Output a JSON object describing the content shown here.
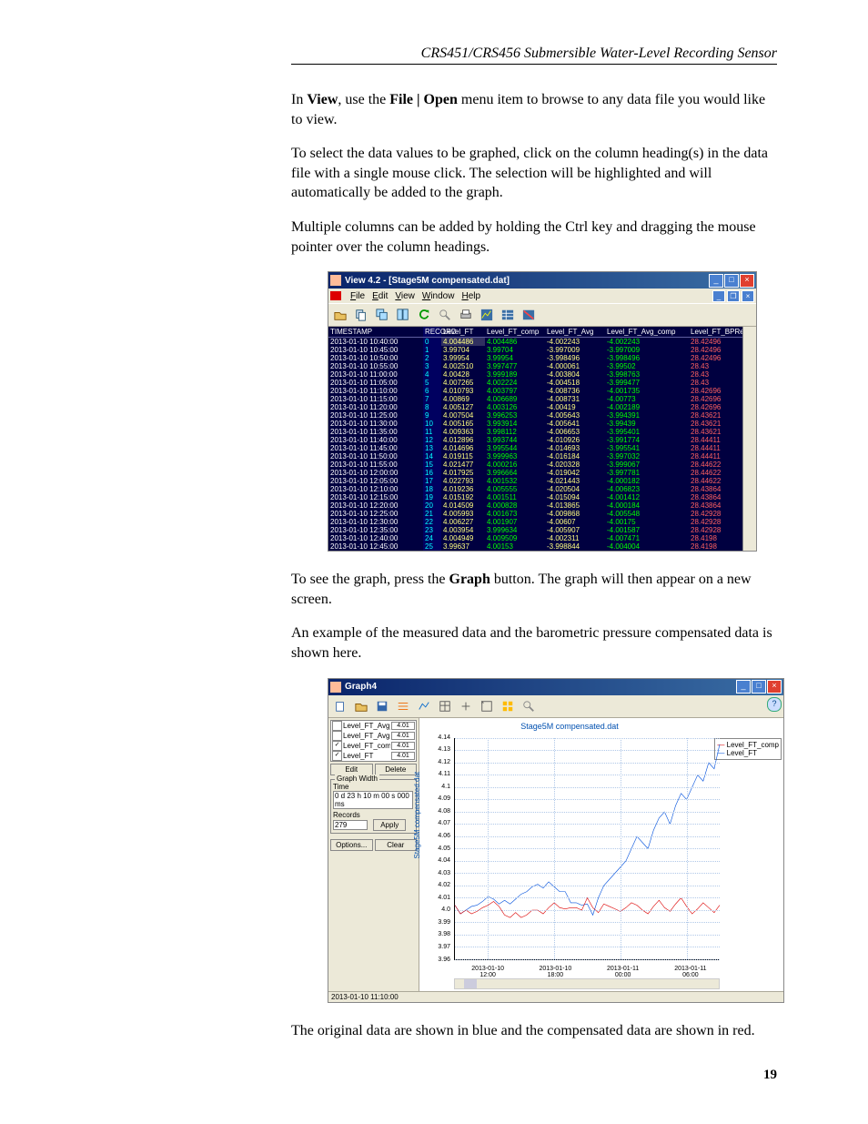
{
  "header": {
    "title": "CRS451/CRS456 Submersible Water-Level Recording Sensor"
  },
  "para1_pre": "In ",
  "para1_b1": "View",
  "para1_mid": ", use the ",
  "para1_b2": "File | Open",
  "para1_post": " menu item to browse to any data file you would like to view.",
  "para2": "To select the data values to be graphed, click on the column heading(s) in the data file with a single mouse click.  The selection will be highlighted and will automatically be added to the graph.",
  "para3": "Multiple columns can be added by holding the Ctrl key and dragging the mouse pointer over the column headings.",
  "para4_pre": "To see the graph, press the ",
  "para4_b": "Graph",
  "para4_post": " button.  The graph will then appear on a new screen.",
  "para5": "An example of the measured data and the barometric pressure compensated data is shown here.",
  "para6": "The original data are shown in blue and the compensated data are shown in red.",
  "pagenum": "19",
  "win1": {
    "title": "View 4.2 - [Stage5M compensated.dat]",
    "menu": [
      "File",
      "Edit",
      "View",
      "Window",
      "Help"
    ],
    "cols": [
      "TIMESTAMP",
      "RECORD",
      "Level_FT",
      "Level_FT_comp",
      "Level_FT_Avg",
      "Level_FT_Avg_comp",
      "Level_FT_BPRef"
    ],
    "rows": [
      [
        "2013-01-10 10:40:00",
        "0",
        "4.004486",
        "4.004486",
        "-4.002243",
        "-4.002243",
        "28.42496"
      ],
      [
        "2013-01-10 10:45:00",
        "1",
        "3.99704",
        "3.99704",
        "-3.997009",
        "-3.997009",
        "28.42496"
      ],
      [
        "2013-01-10 10:50:00",
        "2",
        "3.99954",
        "3.99954",
        "-3.998496",
        "-3.998496",
        "28.42496"
      ],
      [
        "2013-01-10 10:55:00",
        "3",
        "4.002510",
        "3.997477",
        "-4.000061",
        "-3.99502",
        "28.43"
      ],
      [
        "2013-01-10 11:00:00",
        "4",
        "4.00428",
        "3.999189",
        "-4.003804",
        "-3.998763",
        "28.43"
      ],
      [
        "2013-01-10 11:05:00",
        "5",
        "4.007265",
        "4.002224",
        "-4.004518",
        "-3.999477",
        "28.43"
      ],
      [
        "2013-01-10 11:10:00",
        "6",
        "4.010793",
        "4.003797",
        "-4.008736",
        "-4.001735",
        "28.42696"
      ],
      [
        "2013-01-10 11:15:00",
        "7",
        "4.00869",
        "4.006689",
        "-4.008731",
        "-4.00773",
        "28.42696"
      ],
      [
        "2013-01-10 11:20:00",
        "8",
        "4.005127",
        "4.003126",
        "-4.00419",
        "-4.002189",
        "28.42696"
      ],
      [
        "2013-01-10 11:25:00",
        "9",
        "4.007504",
        "3.996253",
        "-4.005643",
        "-3.994391",
        "28.43621"
      ],
      [
        "2013-01-10 11:30:00",
        "10",
        "4.005165",
        "3.993914",
        "-4.005641",
        "-3.99439",
        "28.43621"
      ],
      [
        "2013-01-10 11:35:00",
        "11",
        "4.009363",
        "3.998112",
        "-4.006653",
        "-3.995401",
        "28.43621"
      ],
      [
        "2013-01-10 11:40:00",
        "12",
        "4.012896",
        "3.993744",
        "-4.010926",
        "-3.991774",
        "28.44411"
      ],
      [
        "2013-01-10 11:45:00",
        "13",
        "4.014696",
        "3.995544",
        "-4.014693",
        "-3.995541",
        "28.44411"
      ],
      [
        "2013-01-10 11:50:00",
        "14",
        "4.019115",
        "3.999963",
        "-4.016184",
        "-3.997032",
        "28.44411"
      ],
      [
        "2013-01-10 11:55:00",
        "15",
        "4.021477",
        "4.000216",
        "-4.020328",
        "-3.999067",
        "28.44622"
      ],
      [
        "2013-01-10 12:00:00",
        "16",
        "4.017925",
        "3.996664",
        "-4.019042",
        "-3.997781",
        "28.44622"
      ],
      [
        "2013-01-10 12:05:00",
        "17",
        "4.022793",
        "4.001532",
        "-4.021443",
        "-4.000182",
        "28.44622"
      ],
      [
        "2013-01-10 12:10:00",
        "18",
        "4.019236",
        "4.005555",
        "-4.020504",
        "-4.006823",
        "28.43864"
      ],
      [
        "2013-01-10 12:15:00",
        "19",
        "4.015192",
        "4.001511",
        "-4.015094",
        "-4.001412",
        "28.43864"
      ],
      [
        "2013-01-10 12:20:00",
        "20",
        "4.014509",
        "4.000828",
        "-4.013865",
        "-4.000184",
        "28.43864"
      ],
      [
        "2013-01-10 12:25:00",
        "21",
        "4.005993",
        "4.001673",
        "-4.009868",
        "-4.005548",
        "28.42928"
      ],
      [
        "2013-01-10 12:30:00",
        "22",
        "4.006227",
        "4.001907",
        "-4.00607",
        "-4.00175",
        "28.42928"
      ],
      [
        "2013-01-10 12:35:00",
        "23",
        "4.003954",
        "3.999634",
        "-4.005907",
        "-4.001587",
        "28.42928"
      ],
      [
        "2013-01-10 12:40:00",
        "24",
        "4.004949",
        "4.009509",
        "-4.002311",
        "-4.007471",
        "28.4198"
      ],
      [
        "2013-01-10 12:45:00",
        "25",
        "3.99637",
        "4.00153",
        "-3.998844",
        "-4.004004",
        "28.4198"
      ]
    ]
  },
  "win2": {
    "title": "Graph4",
    "chart_title": "Stage5M compensated.dat",
    "ylabel": "Stage5M compensated.dat",
    "series_panel": [
      {
        "chk": "",
        "name": "Level_FT_Avg_com",
        "val": "4.01"
      },
      {
        "chk": "",
        "name": "Level_FT_Avg",
        "val": "4.01"
      },
      {
        "chk": "✓",
        "name": "Level_FT_comp",
        "val": "4.01"
      },
      {
        "chk": "✓",
        "name": "Level_FT",
        "val": "4.01"
      }
    ],
    "btn_edit": "Edit",
    "btn_delete": "Delete",
    "btn_options": "Options...",
    "btn_clear": "Clear",
    "btn_apply": "Apply",
    "gw_legend": "Graph Width",
    "gw_time": "Time",
    "gw_time_val": "0 d 23 h 10 m 00 s 000 ms",
    "gw_records": "Records",
    "gw_records_val": "279",
    "legend1": "Level_FT_comp",
    "legend2": "Level_FT",
    "yticks": [
      "4.14",
      "4.13",
      "4.12",
      "4.11",
      "4.1",
      "4.09",
      "4.08",
      "4.07",
      "4.06",
      "4.05",
      "4.04",
      "4.03",
      "4.02",
      "4.01",
      "4.0",
      "3.99",
      "3.98",
      "3.97",
      "3.96"
    ],
    "xticks": [
      "2013-01-10\n12:00",
      "2013-01-10\n18:00",
      "2013-01-11\n00:00",
      "2013-01-11\n06:00"
    ],
    "status": "2013-01-10 11:10:00"
  },
  "chart_data": {
    "type": "line",
    "title": "Stage5M compensated.dat",
    "ylabel": "Stage5M compensated.dat",
    "ylim": [
      3.96,
      4.14
    ],
    "x_range": [
      "2013-01-10 10:40",
      "2013-01-11 09:50"
    ],
    "series": [
      {
        "name": "Level_FT_comp",
        "color": "red",
        "values": [
          4.004,
          3.997,
          4.0,
          3.997,
          3.999,
          4.002,
          4.004,
          4.007,
          4.003,
          3.996,
          3.994,
          3.998,
          3.994,
          3.996,
          4.0,
          4.0,
          3.997,
          4.002,
          4.006,
          4.002,
          4.001,
          4.002,
          4.002,
          4.0,
          4.01,
          4.002,
          3.998,
          4.005,
          4.003,
          4.001,
          3.999,
          4.002,
          4.006,
          4.004,
          4.0,
          3.997,
          4.003,
          4.008,
          4.002,
          3.999,
          4.005,
          4.01,
          4.003,
          3.997,
          4.001,
          4.006,
          4.002,
          3.998,
          4.004
        ]
      },
      {
        "name": "Level_FT",
        "color": "blue",
        "values": [
          4.004,
          3.997,
          4.0,
          4.003,
          4.004,
          4.007,
          4.011,
          4.009,
          4.005,
          4.008,
          4.005,
          4.009,
          4.013,
          4.015,
          4.019,
          4.021,
          4.018,
          4.023,
          4.019,
          4.015,
          4.015,
          4.006,
          4.006,
          4.004,
          4.005,
          3.996,
          4.01,
          4.02,
          4.025,
          4.03,
          4.035,
          4.04,
          4.05,
          4.06,
          4.055,
          4.05,
          4.065,
          4.075,
          4.08,
          4.07,
          4.085,
          4.095,
          4.09,
          4.1,
          4.11,
          4.105,
          4.12,
          4.115,
          4.135
        ]
      }
    ]
  }
}
